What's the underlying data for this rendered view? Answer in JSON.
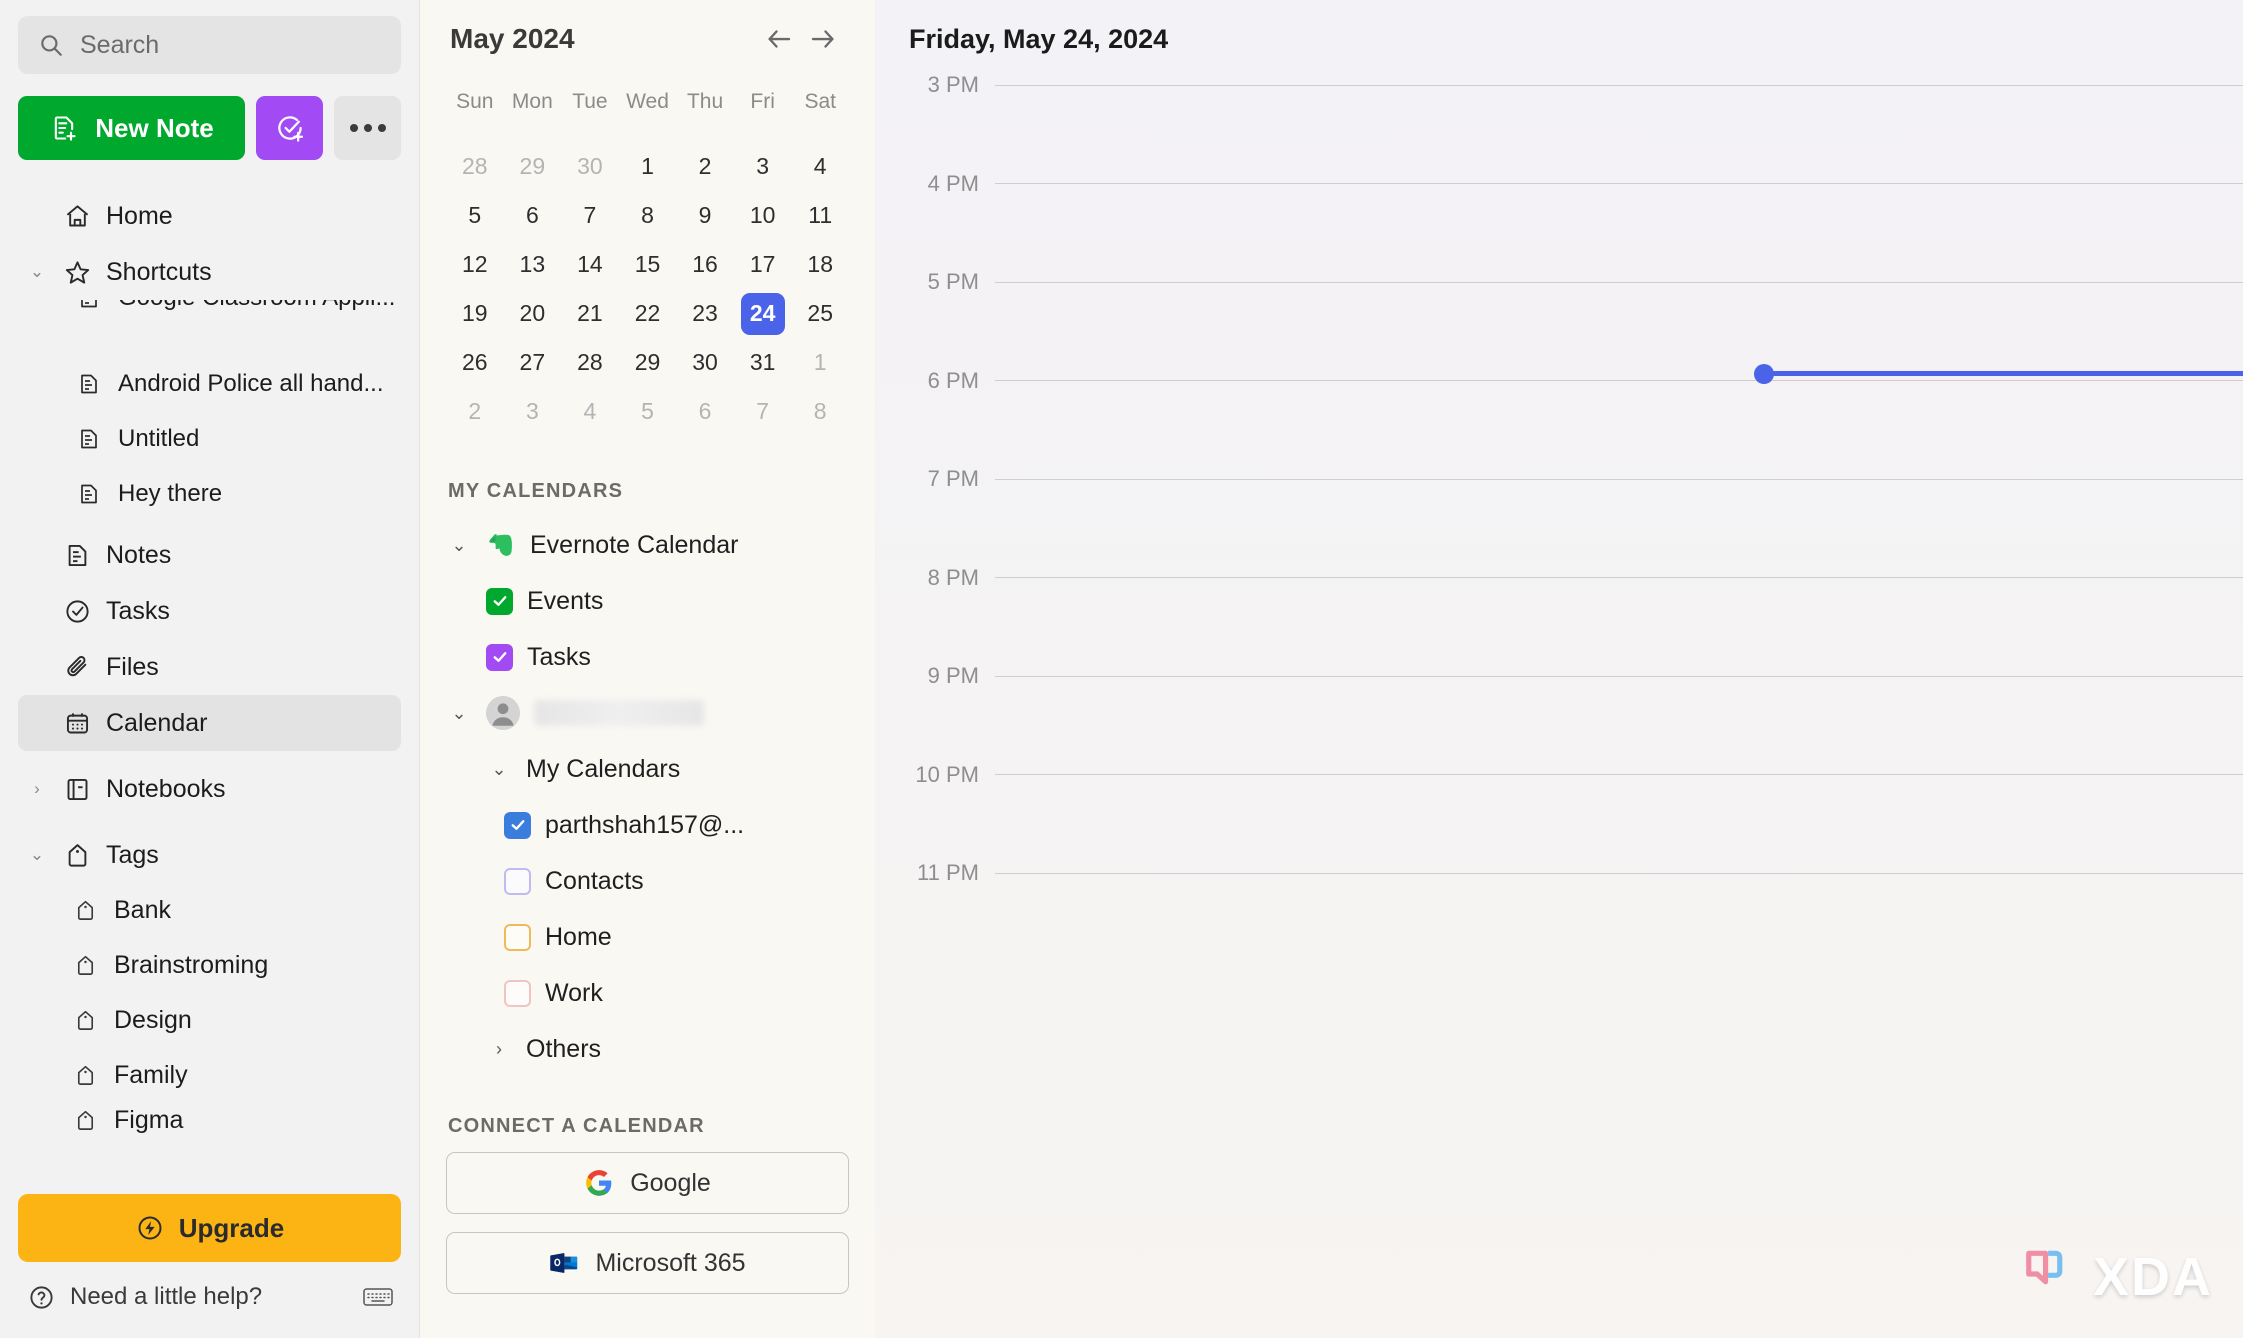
{
  "sidebar": {
    "search": {
      "placeholder": "Search"
    },
    "buttons": {
      "new_note": "New Note",
      "new_task_icon": "task-check-plus-icon",
      "more_icon": "ellipsis-icon"
    },
    "nav": [
      {
        "label": "Home",
        "icon": "home-icon",
        "chevron": "",
        "level": 0,
        "active": false
      },
      {
        "label": "Shortcuts",
        "icon": "star-icon",
        "chevron": "⌄",
        "level": 0,
        "active": false
      }
    ],
    "shortcuts": [
      {
        "label": "Google Classroom Appli...",
        "icon": "note-icon"
      },
      {
        "label": "Android Police all hand...",
        "icon": "note-icon"
      },
      {
        "label": "Untitled",
        "icon": "note-icon"
      },
      {
        "label": "Hey there",
        "icon": "note-icon"
      }
    ],
    "nav2": [
      {
        "label": "Notes",
        "icon": "note-icon",
        "active": false
      },
      {
        "label": "Tasks",
        "icon": "check-circle-icon",
        "active": false
      },
      {
        "label": "Files",
        "icon": "paperclip-icon",
        "active": false
      },
      {
        "label": "Calendar",
        "icon": "calendar-icon",
        "active": true
      }
    ],
    "notebooks": {
      "label": "Notebooks",
      "icon": "notebook-icon",
      "chevron": "›"
    },
    "tags_header": {
      "label": "Tags",
      "icon": "tag-icon",
      "chevron": "⌄"
    },
    "tags": [
      {
        "label": "Bank",
        "icon": "tag-icon"
      },
      {
        "label": "Brainstroming",
        "icon": "tag-icon"
      },
      {
        "label": "Design",
        "icon": "tag-icon"
      },
      {
        "label": "Family",
        "icon": "tag-icon"
      },
      {
        "label": "Figma",
        "icon": "tag-icon"
      }
    ],
    "upgrade": {
      "label": "Upgrade",
      "icon": "bolt-circle-icon"
    },
    "help": {
      "label": "Need a little help?",
      "icon": "question-circle-icon",
      "keyboard_icon": "keyboard-icon"
    }
  },
  "minical": {
    "title": "May 2024",
    "prev_icon": "arrow-left-icon",
    "next_icon": "arrow-right-icon",
    "dow": [
      "Sun",
      "Mon",
      "Tue",
      "Wed",
      "Thu",
      "Fri",
      "Sat"
    ],
    "weeks": [
      [
        {
          "d": "28",
          "m": true
        },
        {
          "d": "29",
          "m": true
        },
        {
          "d": "30",
          "m": true
        },
        {
          "d": "1"
        },
        {
          "d": "2"
        },
        {
          "d": "3"
        },
        {
          "d": "4"
        }
      ],
      [
        {
          "d": "5"
        },
        {
          "d": "6"
        },
        {
          "d": "7"
        },
        {
          "d": "8"
        },
        {
          "d": "9"
        },
        {
          "d": "10"
        },
        {
          "d": "11"
        }
      ],
      [
        {
          "d": "12"
        },
        {
          "d": "13"
        },
        {
          "d": "14"
        },
        {
          "d": "15"
        },
        {
          "d": "16"
        },
        {
          "d": "17"
        },
        {
          "d": "18"
        }
      ],
      [
        {
          "d": "19"
        },
        {
          "d": "20"
        },
        {
          "d": "21"
        },
        {
          "d": "22"
        },
        {
          "d": "23"
        },
        {
          "d": "24",
          "s": true
        },
        {
          "d": "25"
        }
      ],
      [
        {
          "d": "26"
        },
        {
          "d": "27"
        },
        {
          "d": "28"
        },
        {
          "d": "29"
        },
        {
          "d": "30"
        },
        {
          "d": "31"
        },
        {
          "d": "1",
          "m": true
        }
      ],
      [
        {
          "d": "2",
          "m": true
        },
        {
          "d": "3",
          "m": true
        },
        {
          "d": "4",
          "m": true
        },
        {
          "d": "5",
          "m": true
        },
        {
          "d": "6",
          "m": true
        },
        {
          "d": "7",
          "m": true
        },
        {
          "d": "8",
          "m": true
        }
      ]
    ],
    "selected_color": "#4b63e8"
  },
  "calendars": {
    "section_title": "MY CALENDARS",
    "evernote": {
      "label": "Evernote Calendar",
      "icon": "evernote-elephant-icon",
      "children": [
        {
          "label": "Events",
          "checked": true,
          "color": "#00a82d"
        },
        {
          "label": "Tasks",
          "checked": true,
          "color": "#a24bf5"
        }
      ]
    },
    "account": {
      "label": "",
      "icon": "avatar-icon",
      "my_calendars_label": "My Calendars",
      "items": [
        {
          "label": "parthshah157@...",
          "checked": true,
          "color": "#3b7ddd"
        },
        {
          "label": "Contacts",
          "checked": false,
          "color": "#c0bbf0"
        },
        {
          "label": "Home",
          "checked": false,
          "color": "#f0b95a"
        },
        {
          "label": "Work",
          "checked": false,
          "color": "#eec5c0"
        }
      ],
      "others_label": "Others",
      "others_chevron": "›"
    },
    "connect_title": "CONNECT A CALENDAR",
    "connect": [
      {
        "label": "Google",
        "icon": "google-g-icon"
      },
      {
        "label": "Microsoft 365",
        "icon": "outlook-icon"
      }
    ]
  },
  "dayview": {
    "title": "Friday, May 24, 2024",
    "hours": [
      "3 PM",
      "4 PM",
      "5 PM",
      "6 PM",
      "7 PM",
      "8 PM",
      "9 PM",
      "10 PM",
      "11 PM"
    ],
    "now_indicator": {
      "time": "6 PM",
      "color": "#4b63e8"
    }
  },
  "watermark": {
    "label": "XDA",
    "icon": "xda-bubble-icon"
  }
}
